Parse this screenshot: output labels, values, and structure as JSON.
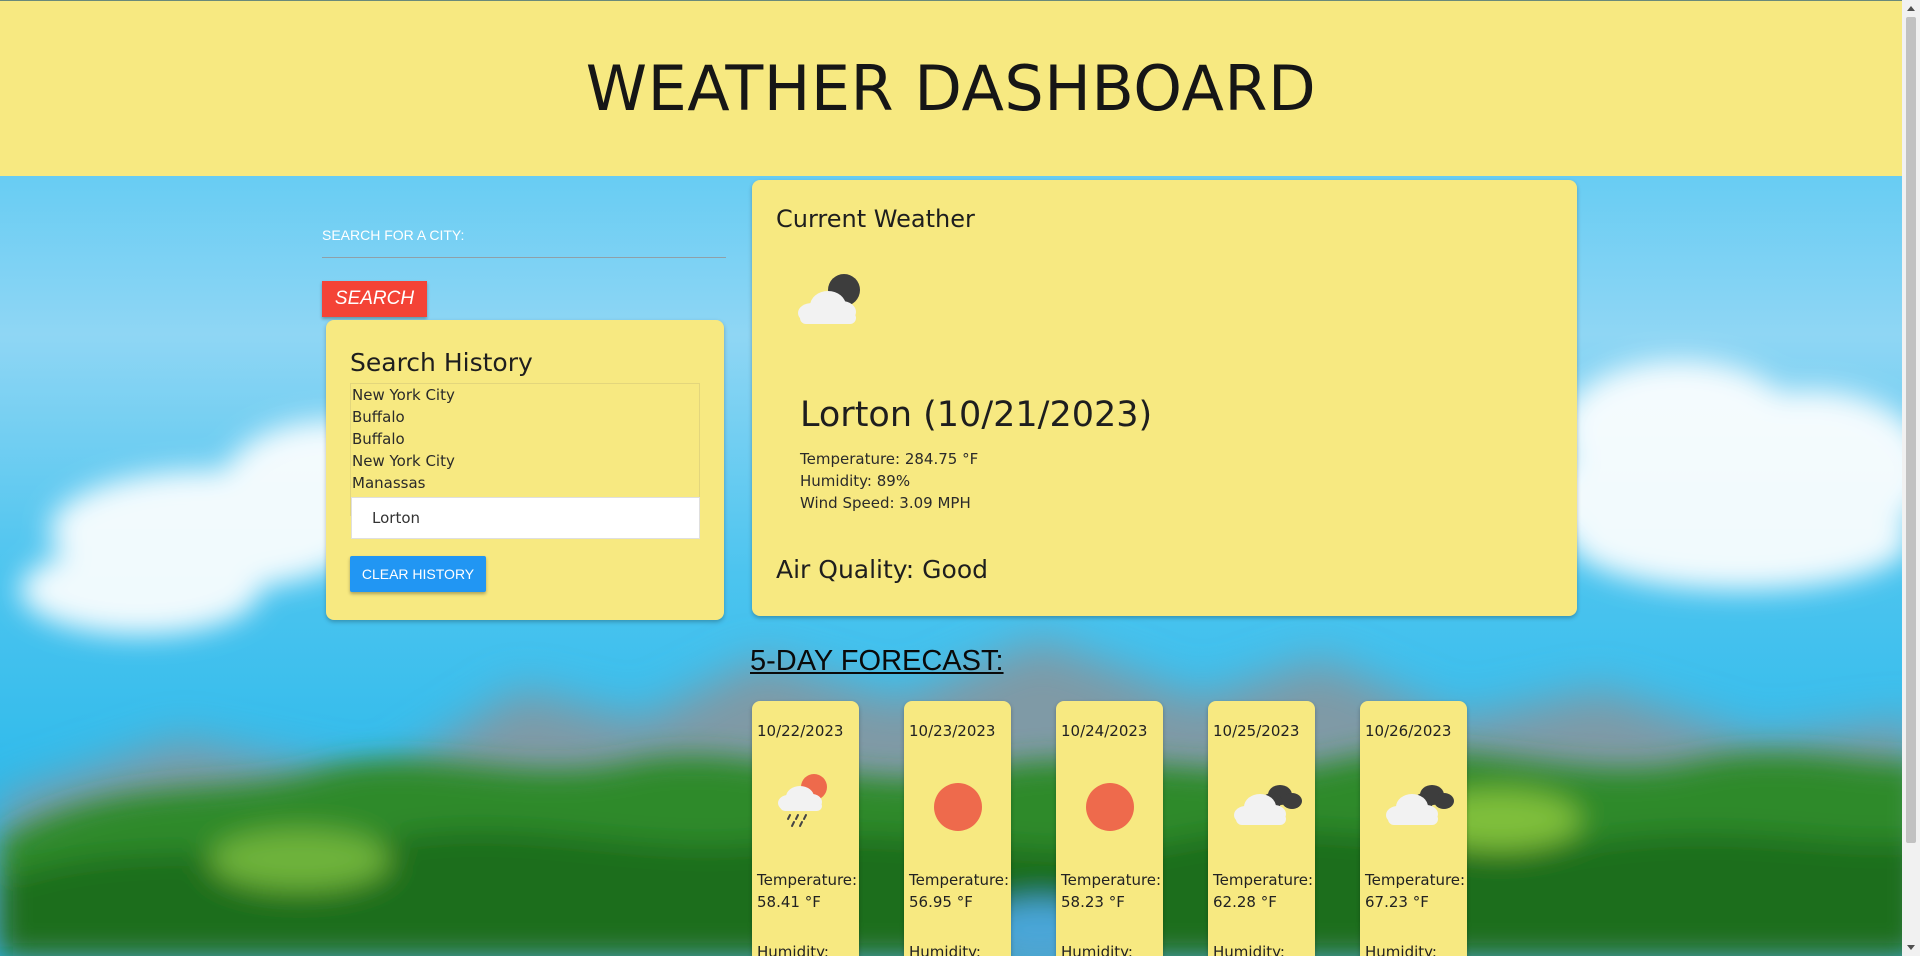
{
  "header": {
    "title": "WEATHER DASHBOARD"
  },
  "search": {
    "label": "SEARCH FOR A CITY:",
    "input_value": "",
    "button_label": "SEARCH"
  },
  "history": {
    "title": "Search History",
    "items": [
      "New York City",
      "Buffalo",
      "Buffalo",
      "New York City",
      "Manassas"
    ],
    "selected": "Lorton",
    "clear_label": "CLEAR HISTORY"
  },
  "current": {
    "title": "Current Weather",
    "icon": "partly-cloudy-night-icon",
    "city_date": "Lorton (10/21/2023)",
    "temperature": "Temperature: 284.75 °F",
    "humidity": "Humidity: 89%",
    "wind": "Wind Speed: 3.09 MPH",
    "air_quality": "Air Quality: Good"
  },
  "forecast": {
    "title": "5-DAY FORECAST:",
    "days": [
      {
        "date": "10/22/2023",
        "icon": "rain-sun-icon",
        "temp_label": "Temperature:",
        "temp_value": "58.41 °F",
        "humidity_label": "Humidity:"
      },
      {
        "date": "10/23/2023",
        "icon": "sun-icon",
        "temp_label": "Temperature:",
        "temp_value": "56.95 °F",
        "humidity_label": "Humidity:"
      },
      {
        "date": "10/24/2023",
        "icon": "sun-icon",
        "temp_label": "Temperature:",
        "temp_value": "58.23 °F",
        "humidity_label": "Humidity:"
      },
      {
        "date": "10/25/2023",
        "icon": "overcast-cloud-icon",
        "temp_label": "Temperature:",
        "temp_value": "62.28 °F",
        "humidity_label": "Humidity:"
      },
      {
        "date": "10/26/2023",
        "icon": "overcast-cloud-icon",
        "temp_label": "Temperature:",
        "temp_value": "67.23 °F",
        "humidity_label": "Humidity:"
      }
    ]
  },
  "colors": {
    "panel": "#f7e981",
    "search_button": "#f44336",
    "clear_button": "#2196f3",
    "sky": "#1ab8ee"
  }
}
